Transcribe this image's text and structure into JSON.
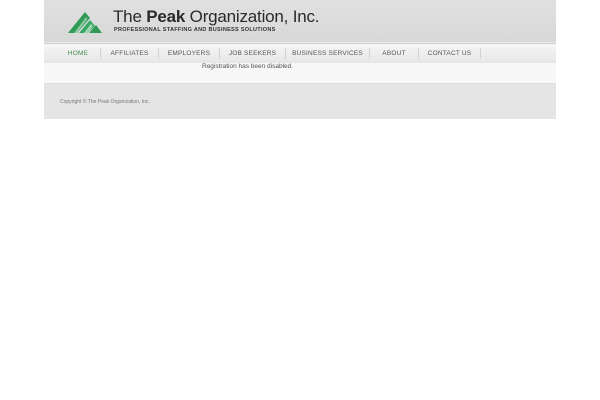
{
  "header": {
    "logo": {
      "name_prefix": "The",
      "name_bold": "Peak",
      "name_suffix": "Organization, Inc.",
      "tagline": "PROFESSIONAL STAFFING AND BUSINESS SOLUTIONS",
      "mark_icon": "peak-mountain-logo-icon",
      "mark_color": "#2e9a56"
    }
  },
  "nav": {
    "active_color": "#3f8b4f",
    "items": [
      {
        "label": "HOME",
        "active": true
      },
      {
        "label": "AFFILIATES",
        "active": false
      },
      {
        "label": "EMPLOYERS",
        "active": false
      },
      {
        "label": "JOB SEEKERS",
        "active": false
      },
      {
        "label": "BUSINESS SERVICES",
        "active": false
      },
      {
        "label": "ABOUT",
        "active": false
      },
      {
        "label": "CONTACT US",
        "active": false
      }
    ]
  },
  "main": {
    "message": "Registration has been disabled."
  },
  "footer": {
    "copyright": "Copyright © The Peak Organization, Inc."
  }
}
